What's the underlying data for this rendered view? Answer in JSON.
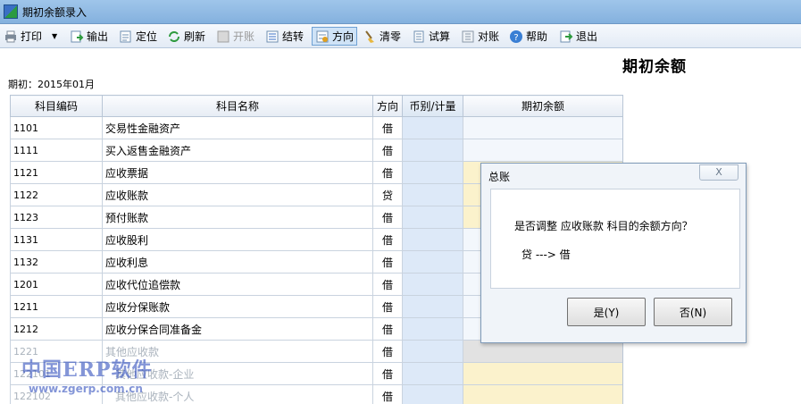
{
  "window": {
    "title": "期初余额录入"
  },
  "toolbar": {
    "print": "打印",
    "export": "输出",
    "locate": "定位",
    "refresh": "刷新",
    "open_account": "开账",
    "carry_forward": "结转",
    "direction": "方向",
    "clear_zero": "清零",
    "trial_balance": "试算",
    "reconcile": "对账",
    "help": "帮助",
    "exit": "退出"
  },
  "sheet": {
    "title": "期初余额",
    "period_label": "期初：2015年01月"
  },
  "table": {
    "headers": [
      "科目编码",
      "科目名称",
      "方向",
      "币别/计量",
      "期初余额"
    ],
    "rows": [
      {
        "code": "1101",
        "name": "交易性金融资产",
        "dir": "借"
      },
      {
        "code": "1111",
        "name": "买入返售金融资产",
        "dir": "借"
      },
      {
        "code": "1121",
        "name": "应收票据",
        "dir": "借"
      },
      {
        "code": "1122",
        "name": "应收账款",
        "dir": "贷"
      },
      {
        "code": "1123",
        "name": "预付账款",
        "dir": "借"
      },
      {
        "code": "1131",
        "name": "应收股利",
        "dir": "借"
      },
      {
        "code": "1132",
        "name": "应收利息",
        "dir": "借"
      },
      {
        "code": "1201",
        "name": "应收代位追偿款",
        "dir": "借"
      },
      {
        "code": "1211",
        "name": "应收分保账款",
        "dir": "借"
      },
      {
        "code": "1212",
        "name": "应收分保合同准备金",
        "dir": "借"
      },
      {
        "code": "1221",
        "name": "其他应收款",
        "dir": "借"
      },
      {
        "code": "122101",
        "name": "其他应收款-企业",
        "dir": "借"
      },
      {
        "code": "122102",
        "name": "其他应收款-个人",
        "dir": "借"
      }
    ]
  },
  "dialog": {
    "title": "总账",
    "close_symbol": "X",
    "message": "是否调整 应收账款 科目的余额方向？",
    "detail": "贷 ---> 借",
    "yes_label": "是(Y)",
    "no_label": "否(N)"
  },
  "watermark": {
    "brand": "中国ERP软件",
    "url": "www.zgerp.com.cn"
  },
  "colors": {
    "titlebar": "#9fc5ea",
    "currency_column": "#dde9f8",
    "balance_highlight": "#fbf2cc"
  }
}
